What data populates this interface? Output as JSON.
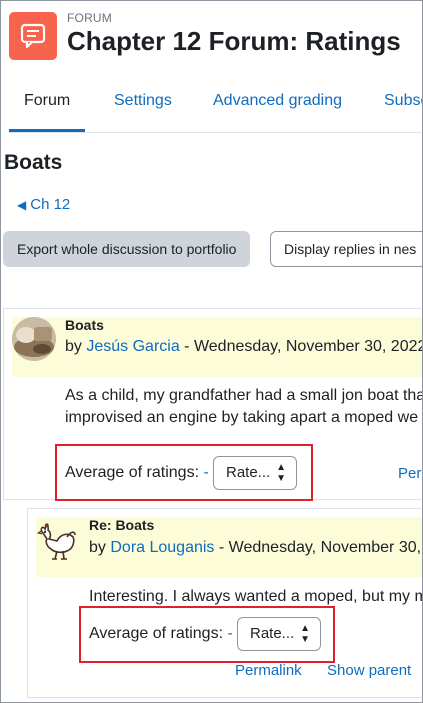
{
  "header": {
    "module_type": "FORUM",
    "title": "Chapter 12 Forum: Ratings"
  },
  "tabs": [
    {
      "label": "Forum",
      "active": true
    },
    {
      "label": "Settings",
      "active": false
    },
    {
      "label": "Advanced grading",
      "active": false
    },
    {
      "label": "Subsc",
      "active": false
    }
  ],
  "discussion": {
    "title": "Boats",
    "back_link": "Ch 12"
  },
  "actions": {
    "export_button": "Export whole discussion to portfolio",
    "display_mode": "Display replies in nes"
  },
  "posts": [
    {
      "subject": "Boats",
      "by": "by",
      "author": "Jesús Garcia",
      "date": " - Wednesday, November 30, 2022",
      "body_lines": [
        "As a child, my grandfather had a small jon boat tha",
        "improvised an engine by taking apart a moped we"
      ],
      "rating_label": "Average of ratings:",
      "rating_value": "-",
      "rate_placeholder": "Rate...",
      "links": [
        "Perr"
      ]
    },
    {
      "subject": "Re: Boats",
      "by": "by",
      "author": "Dora Louganis",
      "date": " - Wednesday, November 30,",
      "body_lines": [
        "Interesting. I always wanted a moped, but my m"
      ],
      "rating_label": "Average of ratings:",
      "rating_value": "-",
      "rate_placeholder": "Rate...",
      "links": [
        "Permalink",
        "Show parent"
      ]
    }
  ],
  "colors": {
    "accent": "#0f6cbf",
    "icon_bg": "#f7634d",
    "highlight": "#e0202c",
    "post_header": "#fcfcd8"
  }
}
